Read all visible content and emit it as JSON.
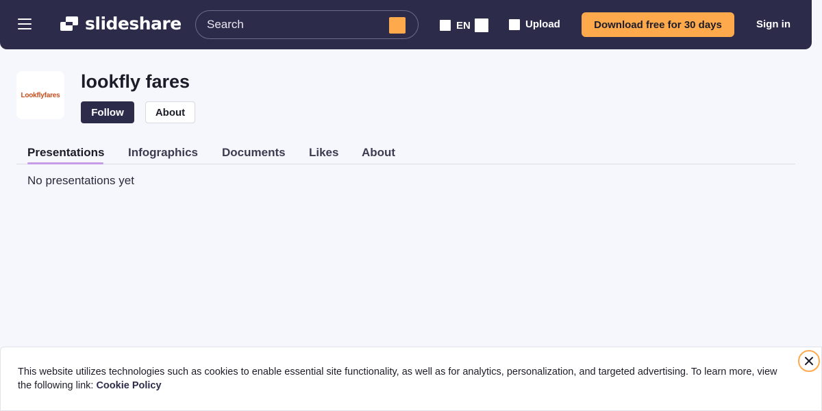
{
  "header": {
    "logo_text": "slideshare",
    "search_placeholder": "Search",
    "language": "EN",
    "upload_label": "Upload",
    "download_label": "Download free for 30 days",
    "signin_label": "Sign in",
    "accent_color": "#ffa94d",
    "bar_color": "#2d2b4a"
  },
  "profile": {
    "avatar_text": "Lookflyfares",
    "name": "lookfly fares",
    "follow_label": "Follow",
    "about_label": "About"
  },
  "tabs": [
    {
      "label": "Presentations",
      "active": true
    },
    {
      "label": "Infographics"
    },
    {
      "label": "Documents"
    },
    {
      "label": "Likes"
    },
    {
      "label": "About"
    }
  ],
  "content": {
    "empty_message": "No presentations yet"
  },
  "cookie_banner": {
    "text": "This website utilizes technologies such as cookies to enable essential site functionality, as well as for analytics, personalization, and targeted advertising. To learn more, view the following link: ",
    "link_label": "Cookie Policy"
  }
}
